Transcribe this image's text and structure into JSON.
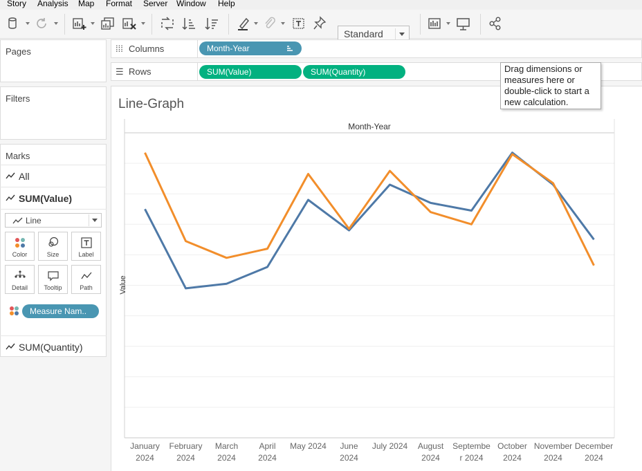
{
  "menu": [
    "Story",
    "Analysis",
    "Map",
    "Format",
    "Server",
    "Window",
    "Help"
  ],
  "toolbar": {
    "fit_select": "Standard",
    "icons": [
      "datasource-icon",
      "refresh-icon",
      "new-worksheet-icon",
      "duplicate-sheet-icon",
      "clear-sheet-icon",
      "swap-icon",
      "sort-ascending-icon",
      "sort-descending-icon",
      "highlight-icon",
      "group-icon",
      "label-icon",
      "pin-icon",
      "show-cards-icon",
      "presentation-icon",
      "share-icon"
    ]
  },
  "pages": {
    "title": "Pages"
  },
  "filters": {
    "title": "Filters"
  },
  "marks": {
    "title": "Marks",
    "all": "All",
    "sum_value": "SUM(Value)",
    "mark_type": "Line",
    "buttons": [
      "Color",
      "Size",
      "Label",
      "Detail",
      "Tooltip",
      "Path"
    ],
    "color_pill": "Measure Nam..",
    "sum_quantity": "SUM(Quantity)"
  },
  "shelves": {
    "columns_label": "Columns",
    "rows_label": "Rows",
    "columns_pill": "Month-Year",
    "rows_pills": [
      "SUM(Value)",
      "SUM(Quantity)"
    ]
  },
  "tooltip": {
    "lines": [
      "Drag dimensions or",
      "measures here or",
      "double-click to start a",
      "new calculation."
    ]
  },
  "sheet": {
    "title": "Line-Graph"
  },
  "chart_data": {
    "type": "line",
    "title": "",
    "column_header": "Month-Year",
    "ylabel": "Value",
    "categories": [
      [
        "January",
        "2024"
      ],
      [
        "February",
        "2024"
      ],
      [
        "March",
        "2024"
      ],
      [
        "April",
        "2024"
      ],
      [
        "May 2024",
        ""
      ],
      [
        "June",
        "2024"
      ],
      [
        "July 2024",
        ""
      ],
      [
        "August",
        "2024"
      ],
      [
        "Septembe",
        "r 2024"
      ],
      [
        "October",
        "2024"
      ],
      [
        "November",
        "2024"
      ],
      [
        "December",
        "2024"
      ]
    ],
    "ylim": [
      0,
      100
    ],
    "grid": true,
    "series": [
      {
        "color": "#4e79a7",
        "values": [
          75,
          49,
          50.5,
          56,
          78,
          68,
          83,
          77,
          74.5,
          93.5,
          83,
          65
        ]
      },
      {
        "color": "#f28e2b",
        "values": [
          93.5,
          64.5,
          59,
          62,
          86.5,
          68.5,
          87.5,
          74,
          70,
          93,
          83.5,
          56.5
        ]
      }
    ]
  },
  "colors": {
    "pill_blue": "#4996b2",
    "pill_green": "#02b180"
  }
}
